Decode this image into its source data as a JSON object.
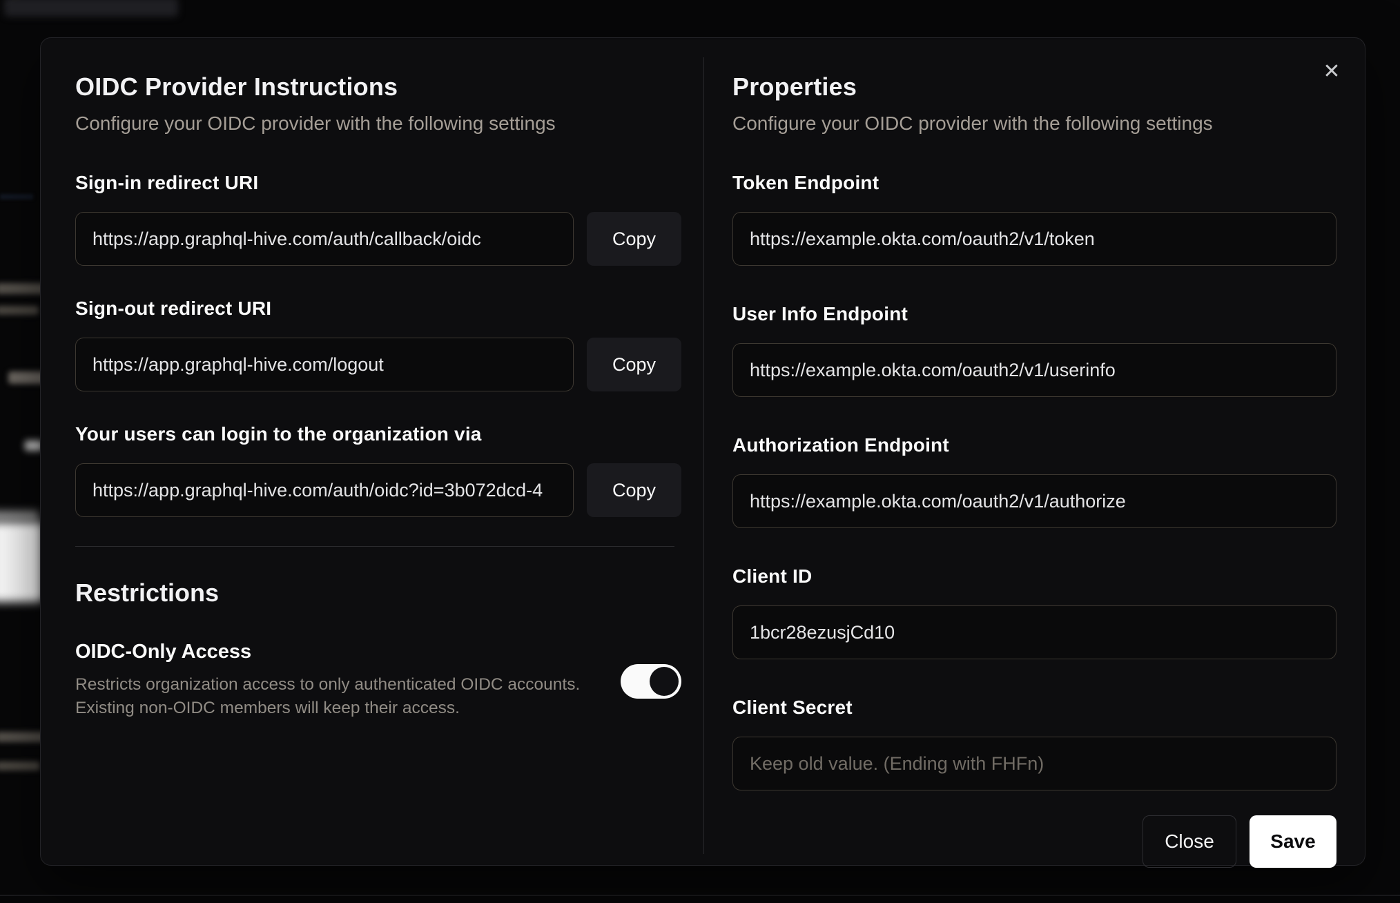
{
  "modal": {
    "close_icon": "✕",
    "left": {
      "title": "OIDC Provider Instructions",
      "subtitle": "Configure your OIDC provider with the following settings",
      "fields": [
        {
          "label": "Sign-in redirect URI",
          "value": "https://app.graphql-hive.com/auth/callback/oidc",
          "copy_label": "Copy"
        },
        {
          "label": "Sign-out redirect URI",
          "value": "https://app.graphql-hive.com/logout",
          "copy_label": "Copy"
        },
        {
          "label": "Your users can login to the organization via",
          "value": "https://app.graphql-hive.com/auth/oidc?id=3b072dcd-4",
          "copy_label": "Copy"
        }
      ],
      "restrictions": {
        "title": "Restrictions",
        "toggle_label": "OIDC-Only Access",
        "description_line1": "Restricts organization access to only authenticated OIDC accounts.",
        "description_line2": "Existing non-OIDC members will keep their access.",
        "toggle_on": true
      }
    },
    "right": {
      "title": "Properties",
      "subtitle": "Configure your OIDC provider with the following settings",
      "fields": [
        {
          "label": "Token Endpoint",
          "value": "https://example.okta.com/oauth2/v1/token",
          "placeholder": ""
        },
        {
          "label": "User Info Endpoint",
          "value": "https://example.okta.com/oauth2/v1/userinfo",
          "placeholder": ""
        },
        {
          "label": "Authorization Endpoint",
          "value": "https://example.okta.com/oauth2/v1/authorize",
          "placeholder": ""
        },
        {
          "label": "Client ID",
          "value": "1bcr28ezusjCd10",
          "placeholder": ""
        },
        {
          "label": "Client Secret",
          "value": "",
          "placeholder": "Keep old value. (Ending with FHFn)"
        }
      ],
      "buttons": {
        "close": "Close",
        "save": "Save"
      }
    }
  },
  "colors": {
    "page_background": "#070708",
    "modal_background": "#0d0d0f",
    "modal_border": "#232327",
    "input_border": "#3d3831",
    "accent_button": "#ffffff",
    "toggle_on_track": "#fafafa",
    "toggle_thumb": "#101013",
    "heading_text": "#f2f2f4",
    "muted_text": "#a59e96"
  }
}
